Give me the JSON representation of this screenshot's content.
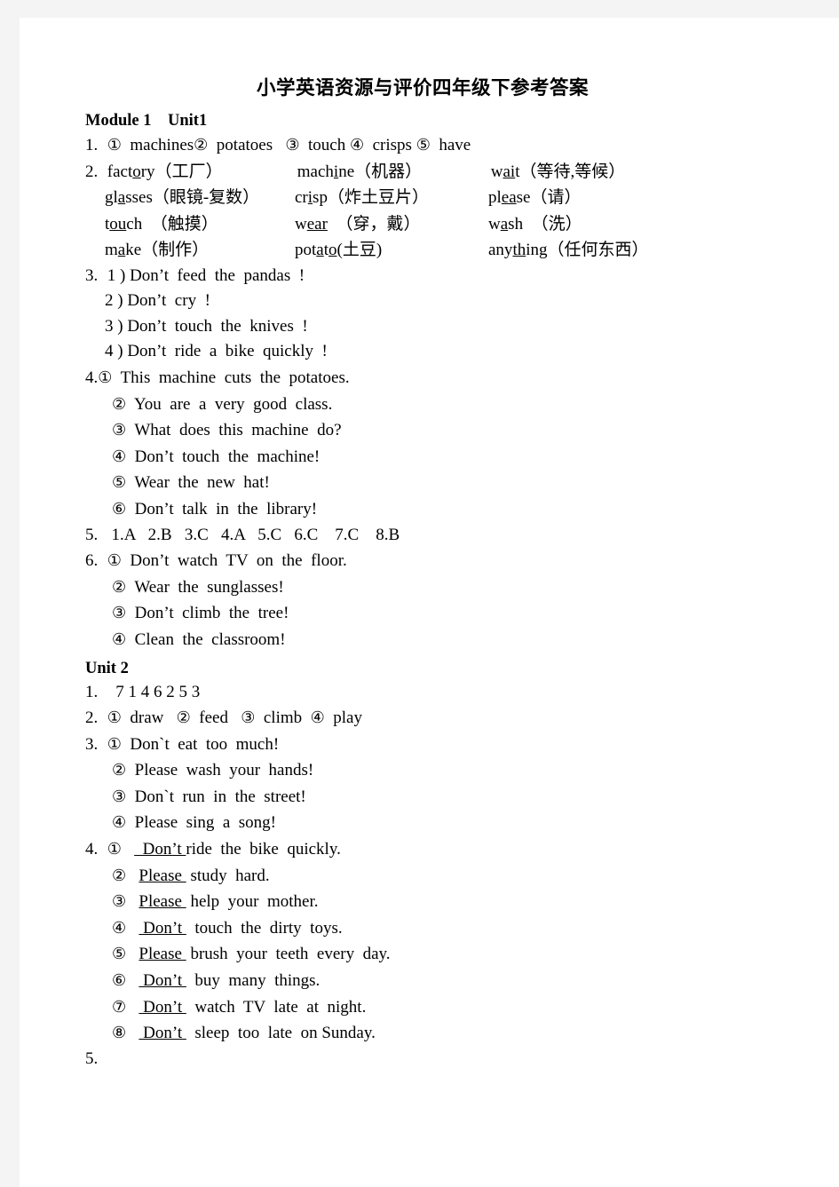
{
  "document": {
    "title": "小学英语资源与评价四年级下参考答案"
  },
  "module1": {
    "heading": "Module 1    Unit1",
    "ex1": {
      "num": "1.",
      "items": [
        {
          "marker": "①",
          "text": "machines"
        },
        {
          "marker": "②",
          "text": "potatoes"
        },
        {
          "marker": "③",
          "text": "touch"
        },
        {
          "marker": "④",
          "text": "crisps"
        },
        {
          "marker": "⑤",
          "text": "have"
        }
      ]
    },
    "ex2": {
      "num": "2.",
      "rows": [
        [
          {
            "pre": "fact",
            "ul": "o",
            "post": "ry",
            "gloss": "（工厂）"
          },
          {
            "pre": "mach",
            "ul": "i",
            "post": "ne",
            "gloss": "（机器）"
          },
          {
            "pre": "w",
            "ul": "ai",
            "post": "t",
            "gloss": "（等待,等候）"
          }
        ],
        [
          {
            "pre": "gl",
            "ul": "a",
            "post": "sses",
            "gloss": "（眼镜-复数）"
          },
          {
            "pre": "cr",
            "ul": "i",
            "post": "sp",
            "gloss": "（炸土豆片）"
          },
          {
            "pre": "pl",
            "ul": "ea",
            "post": "se",
            "gloss": "（请）"
          }
        ],
        [
          {
            "pre": "t",
            "ul": "ou",
            "post": "ch",
            "gloss": "  （触摸）"
          },
          {
            "pre": "w",
            "ul": "ear",
            "post": "",
            "gloss": "  （穿，戴）"
          },
          {
            "pre": "w",
            "ul": "a",
            "post": "sh",
            "gloss": "  （洗）"
          }
        ],
        [
          {
            "pre": "m",
            "ul": "a",
            "post": "ke",
            "gloss": "（制作）"
          },
          {
            "pre": "pot",
            "ul": "a",
            "post": "t",
            "ul2": "o",
            "gloss": "(土豆)"
          },
          {
            "pre": "any",
            "ul": "th",
            "post": "ing",
            "gloss": "（任何东西）"
          }
        ]
      ]
    },
    "ex3": {
      "num": "3.",
      "items": [
        {
          "marker": "1 )",
          "text": "Don’t  feed  the  pandas  !"
        },
        {
          "marker": "2 )",
          "text": "Don’t  cry  !"
        },
        {
          "marker": "3 )",
          "text": "Don’t  touch  the  knives  !"
        },
        {
          "marker": "4 )",
          "text": "Don’t  ride  a  bike  quickly  !"
        }
      ]
    },
    "ex4": {
      "num": "4.",
      "items": [
        {
          "marker": "①",
          "text": "This  machine  cuts  the  potatoes."
        },
        {
          "marker": "②",
          "text": "You  are  a  very  good  class."
        },
        {
          "marker": "③",
          "text": "What  does  this  machine  do?"
        },
        {
          "marker": "④",
          "text": "Don’t  touch  the  machine!"
        },
        {
          "marker": "⑤",
          "text": "Wear  the  new  hat!"
        },
        {
          "marker": "⑥",
          "text": "Don’t  talk  in  the  library!"
        }
      ]
    },
    "ex5": {
      "num": "5.",
      "answers": "1.A   2.B   3.C   4.A   5.C   6.C    7.C    8.B"
    },
    "ex6": {
      "num": "6.",
      "items": [
        {
          "marker": "①",
          "text": "Don’t  watch  TV  on  the  floor."
        },
        {
          "marker": "②",
          "text": "Wear  the  sunglasses!"
        },
        {
          "marker": "③",
          "text": "Don’t  climb  the  tree!"
        },
        {
          "marker": "④",
          "text": "Clean  the  classroom!"
        }
      ]
    }
  },
  "unit2": {
    "heading": "Unit 2",
    "ex1": {
      "num": "1.",
      "answers": "7 1 4 6 2 5 3"
    },
    "ex2": {
      "num": "2.",
      "items": [
        {
          "marker": "①",
          "text": "draw"
        },
        {
          "marker": "②",
          "text": "feed"
        },
        {
          "marker": "③",
          "text": "climb"
        },
        {
          "marker": "④",
          "text": "play"
        }
      ]
    },
    "ex3": {
      "num": "3.",
      "items": [
        {
          "marker": "①",
          "text": "Don`t  eat  too  much!"
        },
        {
          "marker": "②",
          "text": "Please  wash  your  hands!"
        },
        {
          "marker": "③",
          "text": "Don`t  run  in  the  street!"
        },
        {
          "marker": "④",
          "text": "Please  sing  a  song!"
        }
      ]
    },
    "ex4": {
      "num": "4.",
      "items": [
        {
          "marker": "①",
          "blank": "  Don’t ",
          "rest": "ride  the  bike  quickly."
        },
        {
          "marker": "②",
          "blank": "Please ",
          "rest": " study  hard."
        },
        {
          "marker": "③",
          "blank": "Please ",
          "rest": " help  your  mother."
        },
        {
          "marker": "④",
          "blank": " Don’t ",
          "rest": "  touch  the  dirty  toys."
        },
        {
          "marker": "⑤",
          "blank": "Please ",
          "rest": " brush  your  teeth  every  day."
        },
        {
          "marker": "⑥",
          "blank": " Don’t ",
          "rest": "  buy  many  things."
        },
        {
          "marker": "⑦",
          "blank": " Don’t ",
          "rest": "  watch  TV  late  at  night."
        },
        {
          "marker": "⑧",
          "blank": " Don’t ",
          "rest": "  sleep  too  late  on Sunday."
        }
      ]
    },
    "ex5": {
      "num": "5."
    }
  }
}
